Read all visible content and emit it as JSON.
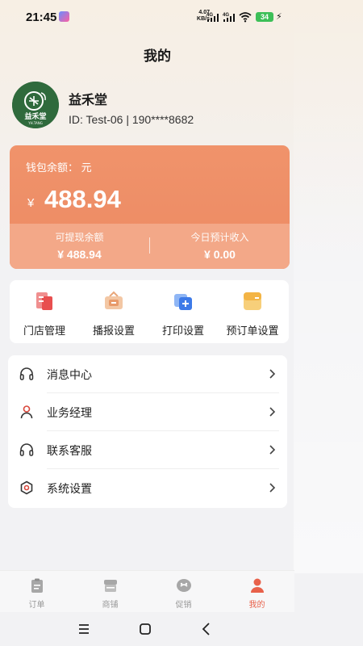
{
  "status_bar": {
    "time": "21:45",
    "speed_value": "4.07",
    "speed_unit": "KB/s",
    "network_1": "4G",
    "network_2": "4G",
    "battery": "34"
  },
  "page": {
    "title": "我的"
  },
  "profile": {
    "name": "益禾堂",
    "id_line": "ID: Test-06 | 190****8682",
    "logo_text": "益禾堂",
    "logo_sub": "YH.TANG"
  },
  "wallet": {
    "label": "钱包余额：  元",
    "currency": "¥",
    "balance": "488.94",
    "withdrawable_label": "可提现余额",
    "withdrawable_value": "¥ 488.94",
    "today_label": "今日预计收入",
    "today_value": "¥ 0.00"
  },
  "functions": [
    {
      "label": "门店管理",
      "icon": "store-manage-icon"
    },
    {
      "label": "播报设置",
      "icon": "broadcast-icon"
    },
    {
      "label": "打印设置",
      "icon": "print-icon"
    },
    {
      "label": "预订单设置",
      "icon": "preorder-icon"
    }
  ],
  "menu": [
    {
      "label": "消息中心",
      "icon": "headset-icon"
    },
    {
      "label": "业务经理",
      "icon": "person-icon"
    },
    {
      "label": "联系客服",
      "icon": "headset-icon"
    },
    {
      "label": "系统设置",
      "icon": "gear-icon"
    }
  ],
  "tabs": [
    {
      "label": "订单",
      "icon": "clipboard-icon",
      "active": false
    },
    {
      "label": "商铺",
      "icon": "shop-icon",
      "active": false
    },
    {
      "label": "促销",
      "icon": "promo-icon",
      "active": false
    },
    {
      "label": "我的",
      "icon": "user-icon",
      "active": true
    }
  ],
  "colors": {
    "accent": "#e8614a",
    "wallet_top": "#f0936b",
    "wallet_bottom": "#f3a888",
    "logo_green": "#2f6a3c"
  }
}
